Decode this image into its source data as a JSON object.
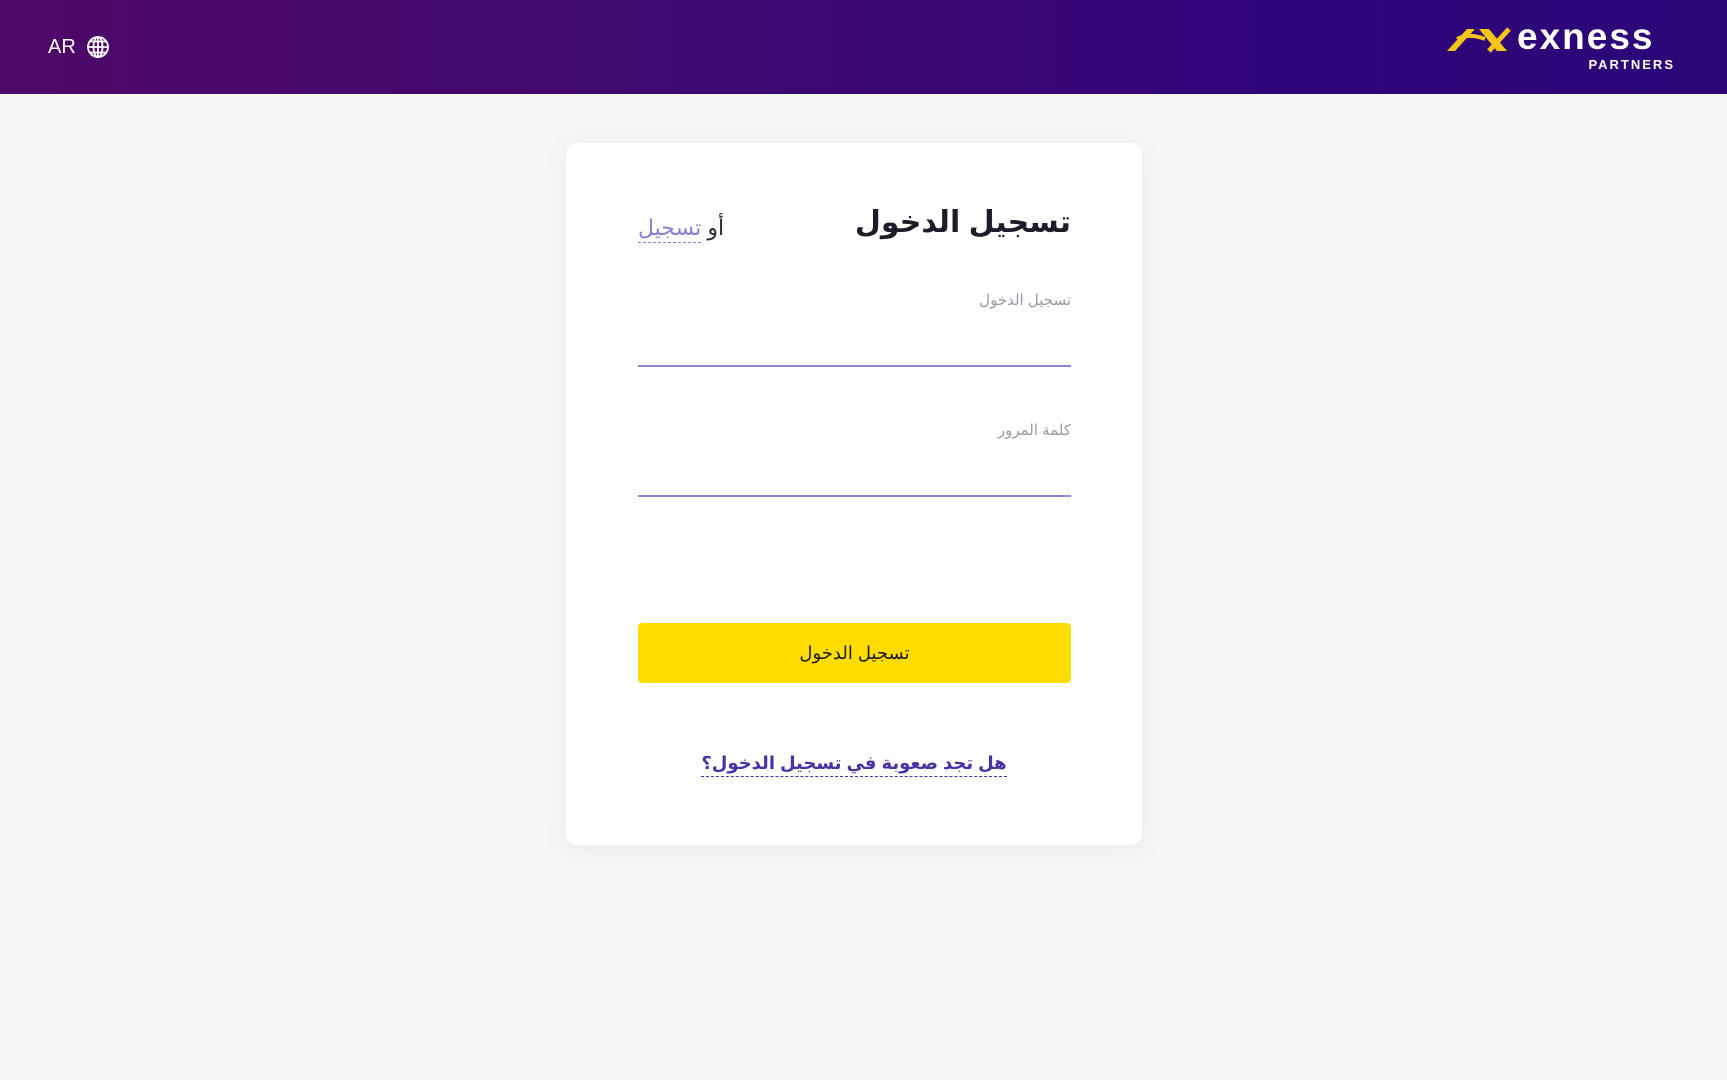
{
  "header": {
    "language_code": "AR",
    "language_icon": "globe-icon",
    "brand": {
      "name": "exness",
      "subtitle": "PARTNERS",
      "logo_icon": "exness-logo-mark"
    }
  },
  "login_card": {
    "title": "تسجيل الدخول",
    "or_label": "أو",
    "register_link": "تسجيل",
    "login_field": {
      "label": "تسجيل الدخول",
      "value": ""
    },
    "password_field": {
      "label": "كلمة المرور",
      "value": ""
    },
    "submit_label": "تسجيل الدخول",
    "trouble_link": "هل تجد صعوبة في تسجيل الدخول؟"
  },
  "colors": {
    "header_gradient_start": "#4e0868",
    "header_gradient_end": "#2a0677",
    "accent_yellow": "#ffdd00",
    "link_purple": "#4a31a8",
    "background": "#f5f8f5"
  }
}
